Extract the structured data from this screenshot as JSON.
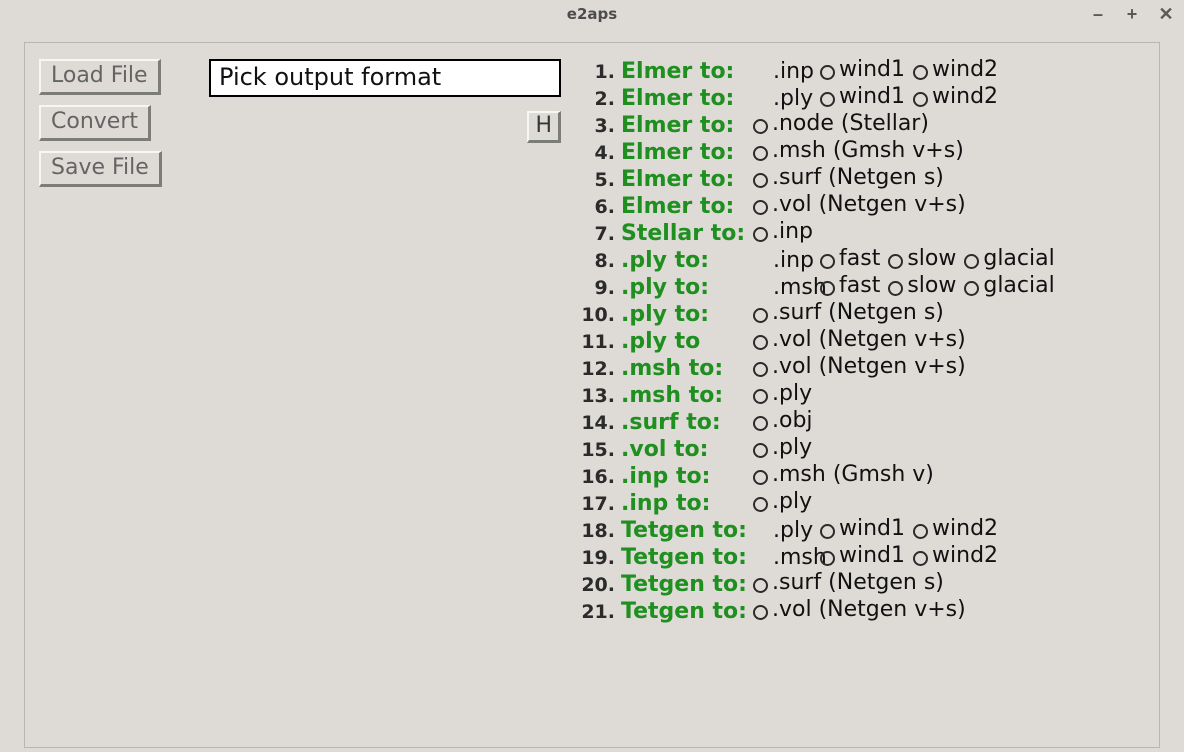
{
  "window": {
    "title": "e2aps"
  },
  "buttons": {
    "load": "Load File",
    "convert": "Convert",
    "save": "Save File",
    "h": "H"
  },
  "instruction": "Pick output format",
  "formats": [
    {
      "n": "1.",
      "src": "Elmer to:",
      "leading_radio": false,
      "target": ".inp",
      "opts": [
        "wind1",
        "wind2"
      ]
    },
    {
      "n": "2.",
      "src": "Elmer to:",
      "leading_radio": false,
      "target": ".ply",
      "opts": [
        "wind1",
        "wind2"
      ]
    },
    {
      "n": "3.",
      "src": "Elmer to:",
      "leading_radio": true,
      "target": ".node (Stellar)",
      "opts": []
    },
    {
      "n": "4.",
      "src": "Elmer to:",
      "leading_radio": true,
      "target": ".msh (Gmsh v+s)",
      "opts": []
    },
    {
      "n": "5.",
      "src": "Elmer to:",
      "leading_radio": true,
      "target": ".surf (Netgen s)",
      "opts": []
    },
    {
      "n": "6.",
      "src": "Elmer to:",
      "leading_radio": true,
      "target": ".vol (Netgen v+s)",
      "opts": []
    },
    {
      "n": "7.",
      "src": "Stellar to:",
      "leading_radio": true,
      "target": ".inp",
      "opts": []
    },
    {
      "n": "8.",
      "src": ".ply to:",
      "leading_radio": false,
      "target": ".inp",
      "opts": [
        "fast",
        "slow",
        "glacial"
      ]
    },
    {
      "n": "9.",
      "src": ".ply to:",
      "leading_radio": false,
      "target": ".msh",
      "opts": [
        "fast",
        "slow",
        "glacial"
      ]
    },
    {
      "n": "10.",
      "src": ".ply to:",
      "leading_radio": true,
      "target": ".surf (Netgen s)",
      "opts": []
    },
    {
      "n": "11.",
      "src": ".ply to",
      "leading_radio": true,
      "target": ".vol (Netgen v+s)",
      "opts": []
    },
    {
      "n": "12.",
      "src": ".msh to:",
      "leading_radio": true,
      "target": ".vol (Netgen v+s)",
      "opts": []
    },
    {
      "n": "13.",
      "src": ".msh to:",
      "leading_radio": true,
      "target": ".ply",
      "opts": []
    },
    {
      "n": "14.",
      "src": ".surf to:",
      "leading_radio": true,
      "target": ".obj",
      "opts": []
    },
    {
      "n": "15.",
      "src": ".vol to:",
      "leading_radio": true,
      "target": ".ply",
      "opts": []
    },
    {
      "n": "16.",
      "src": ".inp to:",
      "leading_radio": true,
      "target": ".msh (Gmsh v)",
      "opts": []
    },
    {
      "n": "17.",
      "src": ".inp to:",
      "leading_radio": true,
      "target": ".ply",
      "opts": []
    },
    {
      "n": "18.",
      "src": "Tetgen to:",
      "leading_radio": false,
      "target": ".ply",
      "opts": [
        "wind1",
        "wind2"
      ]
    },
    {
      "n": "19.",
      "src": "Tetgen to:",
      "leading_radio": false,
      "target": ".msh",
      "opts": [
        "wind1",
        "wind2"
      ]
    },
    {
      "n": "20.",
      "src": "Tetgen to:",
      "leading_radio": true,
      "target": ".surf (Netgen s)",
      "opts": []
    },
    {
      "n": "21.",
      "src": "Tetgen to:",
      "leading_radio": true,
      "target": ".vol (Netgen v+s)",
      "opts": []
    }
  ]
}
